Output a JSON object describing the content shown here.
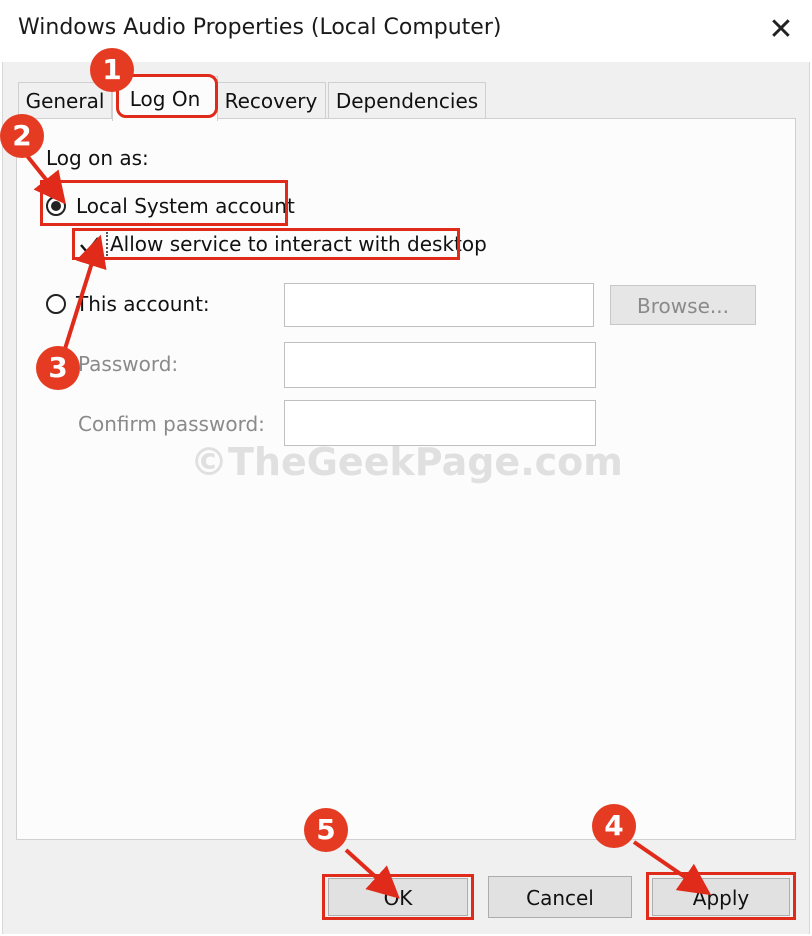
{
  "window": {
    "title": "Windows Audio Properties (Local Computer)",
    "close_glyph": "✕"
  },
  "tabs": [
    {
      "label": "General",
      "active": false
    },
    {
      "label": "Log On",
      "active": true
    },
    {
      "label": "Recovery",
      "active": false
    },
    {
      "label": "Dependencies",
      "active": false
    }
  ],
  "logon": {
    "heading": "Log on as:",
    "local_system_label": "Local System account",
    "local_system_selected": true,
    "interact_desktop_label": "Allow service to interact with desktop",
    "interact_desktop_checked": true,
    "this_account_label": "This account:",
    "this_account_selected": false,
    "this_account_value": "",
    "browse_label": "Browse...",
    "password_label": "Password:",
    "password_value": "",
    "confirm_password_label": "Confirm password:",
    "confirm_password_value": ""
  },
  "footer": {
    "ok_label": "OK",
    "cancel_label": "Cancel",
    "apply_label": "Apply"
  },
  "annotations": {
    "step1": "1",
    "step2": "2",
    "step3": "3",
    "step4": "4",
    "step5": "5",
    "highlight_color": "#e02a1a"
  },
  "watermark": "©TheGeekPage.com"
}
